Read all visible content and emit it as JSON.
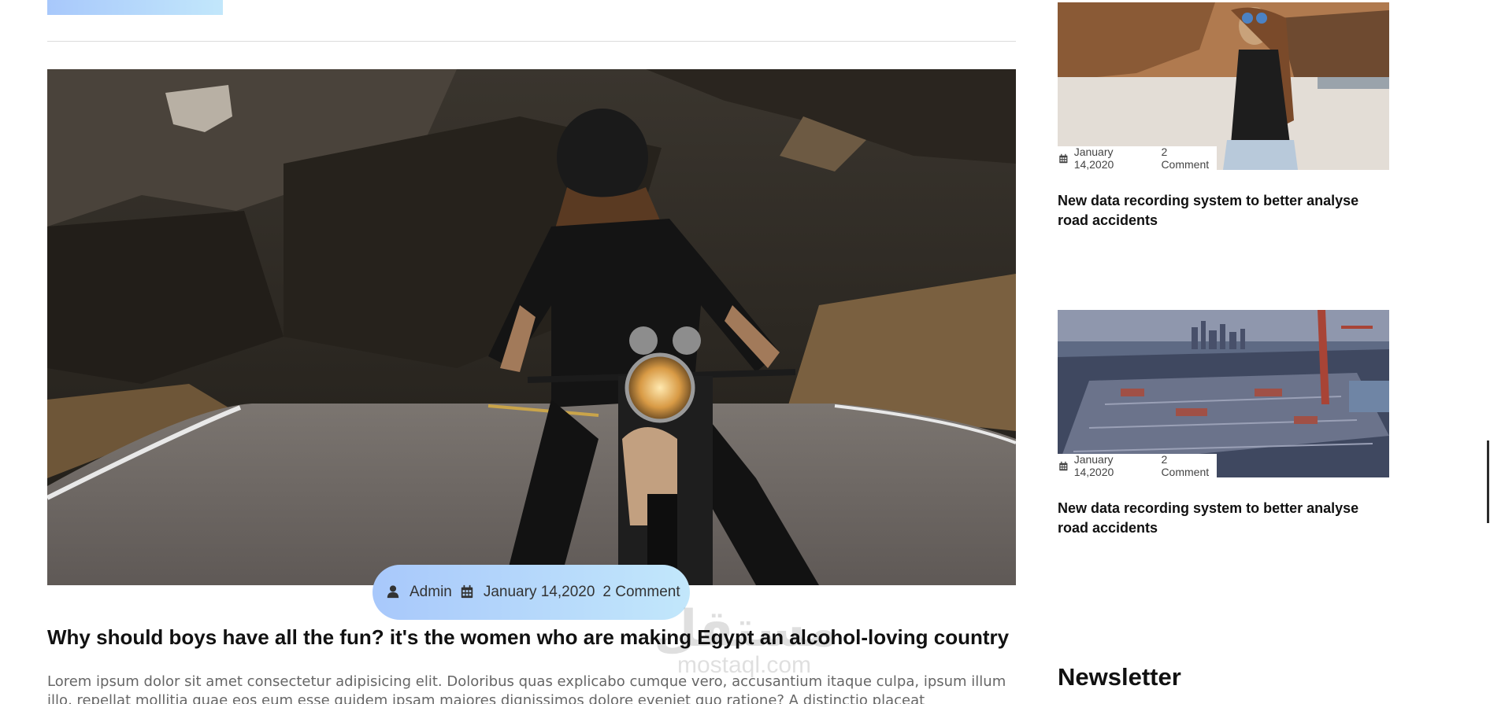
{
  "main": {
    "post": {
      "meta": {
        "author": "Admin",
        "date": "January 14,2020",
        "comments": "2 Comment"
      },
      "title": "Why should boys have all the fun? it's the women who are making Egypt an alcohol-loving country",
      "excerpt": "Lorem ipsum dolor sit amet consectetur adipisicing elit. Doloribus quas explicabo cumque vero, accusantium itaque culpa, ipsum illum illo, repellat mollitia quae eos eum esse quidem ipsam maiores dignissimos dolore eveniet quo ratione? A distinctio placeat repudiandae nam obcaecati iste, ex"
    }
  },
  "sidebar": {
    "cards": [
      {
        "date": "January 14,2020",
        "comments": "2 Comment",
        "title": "New data recording system to better analyse road accidents"
      },
      {
        "date": "January 14,2020",
        "comments": "2 Comment",
        "title": "New data recording system to better analyse road accidents"
      }
    ],
    "newsletter_heading": "Newsletter"
  },
  "watermark": {
    "arabic": "مستقل",
    "latin": "mostaql.com"
  },
  "colors": {
    "gradient_start": "#a8c8fb",
    "gradient_end": "#c2e7fb"
  }
}
